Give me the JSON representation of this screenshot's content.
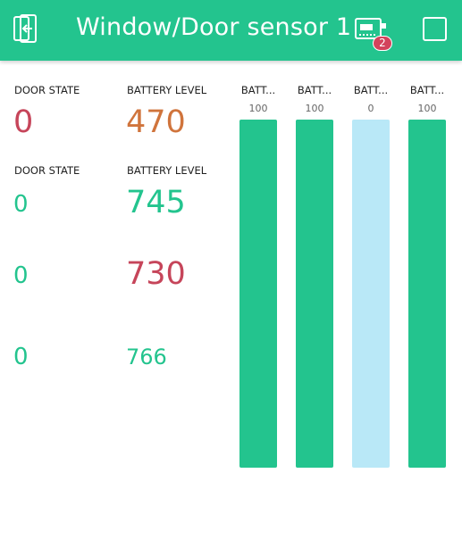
{
  "colors": {
    "accent": "#23c48e",
    "orange": "#d0743c",
    "red": "#c6455a",
    "green": "#23c48e",
    "track": "#b9e8f7"
  },
  "header": {
    "title": "Window/Door sensor 1",
    "back_icon": "exit-icon",
    "device_icon": "device-board-icon",
    "device_badge": "2",
    "menu_icon": "square-icon"
  },
  "widgets": {
    "door_label_1": "DOOR STATE",
    "door_value_1": "0",
    "battery_label_1": "BATTERY LEVEL",
    "battery_value_1": "470",
    "door_label_2": "DOOR STATE",
    "door_value_2": "0",
    "battery_label_2": "BATTERY LEVEL",
    "battery_value_2": "745",
    "door_value_3": "0",
    "battery_value_3": "730",
    "door_value_4": "0",
    "battery_value_4": "766"
  },
  "gauges": [
    {
      "label": "BATT...",
      "value": "100",
      "level": 1.0
    },
    {
      "label": "BATT...",
      "value": "100",
      "level": 1.0
    },
    {
      "label": "BATT...",
      "value": "0",
      "level": 0.0
    },
    {
      "label": "BATT...",
      "value": "100",
      "level": 1.0
    }
  ]
}
